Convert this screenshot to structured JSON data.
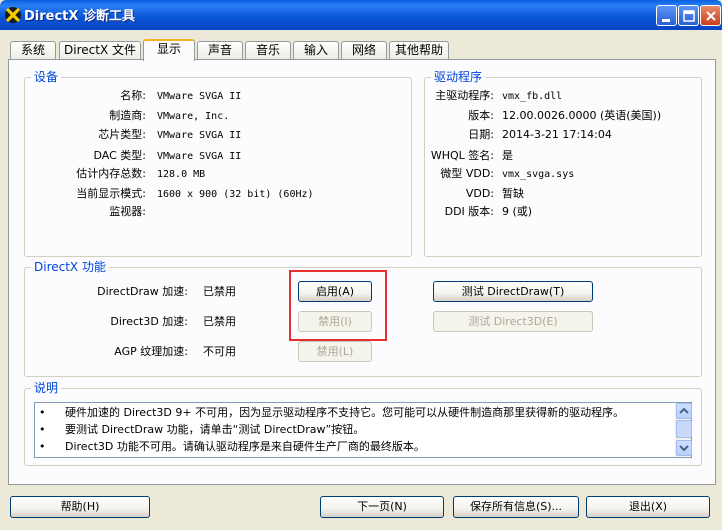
{
  "window": {
    "title": "DirectX 诊断工具"
  },
  "tabs": [
    "系统",
    "DirectX 文件",
    "显示",
    "声音",
    "音乐",
    "输入",
    "网络",
    "其他帮助"
  ],
  "active_tab": "显示",
  "device": {
    "title": "设备",
    "rows": [
      {
        "label": "名称:",
        "value": "VMware SVGA II"
      },
      {
        "label": "制造商:",
        "value": "VMware, Inc."
      },
      {
        "label": "芯片类型:",
        "value": "VMware SVGA II"
      },
      {
        "label": "DAC 类型:",
        "value": "VMware SVGA II"
      },
      {
        "label": "估计内存总数:",
        "value": "128.0 MB"
      },
      {
        "label": "当前显示模式:",
        "value": "1600 x 900 (32 bit) (60Hz)"
      },
      {
        "label": "监视器:",
        "value": ""
      }
    ]
  },
  "driver": {
    "title": "驱动程序",
    "rows": [
      {
        "label": "主驱动程序:",
        "value": "vmx_fb.dll"
      },
      {
        "label": "版本:",
        "value": "12.00.0026.0000 (英语(美国))"
      },
      {
        "label": "日期:",
        "value": "2014-3-21 17:14:04"
      },
      {
        "label": "WHQL 签名:",
        "value": "是"
      },
      {
        "label": "微型 VDD:",
        "value": "vmx_svga.sys"
      },
      {
        "label": "VDD:",
        "value": "暂缺"
      },
      {
        "label": "DDI 版本:",
        "value": "9 (或)"
      }
    ]
  },
  "features": {
    "title": "DirectX 功能",
    "rows": [
      {
        "label": "DirectDraw 加速:",
        "status": "已禁用",
        "button": "启用(A)",
        "test": "测试 DirectDraw(T)"
      },
      {
        "label": "Direct3D 加速:",
        "status": "已禁用",
        "button": "禁用(I)",
        "test": "测试 Direct3D(E)"
      },
      {
        "label": "AGP 纹理加速:",
        "status": "不可用",
        "button": "禁用(L)",
        "test": ""
      }
    ]
  },
  "notes": {
    "title": "说明",
    "items": [
      "硬件加速的 Direct3D 9+ 不可用，因为显示驱动程序不支持它。您可能可以从硬件制造商那里获得新的驱动程序。",
      "要测试 DirectDraw 功能，请单击“测试 DirectDraw”按钮。",
      "Direct3D 功能不可用。请确认驱动程序是来自硬件生产厂商的最终版本。"
    ]
  },
  "bottom_buttons": {
    "help": "帮助(H)",
    "next": "下一页(N)",
    "save": "保存所有信息(S)...",
    "exit": "退出(X)"
  },
  "colors": {
    "group_title": "#0046d5",
    "highlight": "#e5302f",
    "titlebar": "#0a5fe0"
  }
}
